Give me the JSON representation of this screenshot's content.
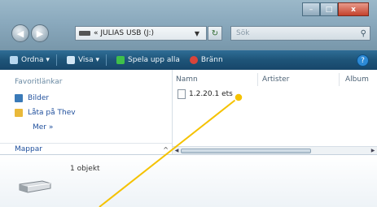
{
  "window": {
    "close_label": "x"
  },
  "address": {
    "path": "« JULIAS USB (J:)"
  },
  "search": {
    "placeholder": "Sök"
  },
  "toolbar": {
    "items": [
      {
        "label": "Ordna ▾"
      },
      {
        "label": "Visa ▾"
      },
      {
        "label": "Spela upp alla"
      },
      {
        "label": "Bränn"
      }
    ]
  },
  "navpane": {
    "heading": "Favoritlänkar",
    "links": [
      {
        "label": "Bilder"
      },
      {
        "label": "Låta på Thev"
      }
    ],
    "more": "Mer »",
    "folders": "Mappar"
  },
  "filelist": {
    "columns": [
      "Namn",
      "Artister",
      "Album"
    ],
    "files": [
      {
        "name": "1.2.20.1 ets"
      }
    ]
  },
  "details": {
    "item_count": "1 objekt"
  },
  "colors": {
    "toolbar": "#1e5478",
    "callout": "#f5c200"
  }
}
